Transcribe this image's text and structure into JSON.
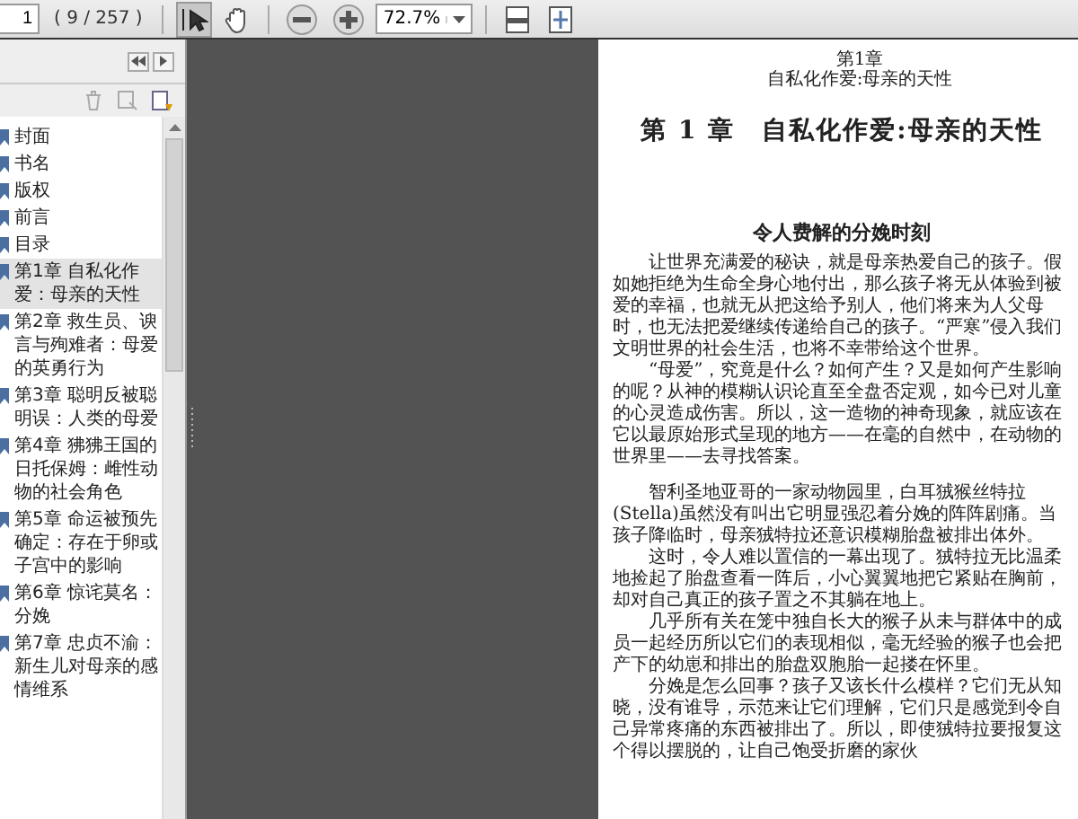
{
  "toolbar": {
    "page_number": "1",
    "page_count": "( 9 / 257 )",
    "tools": [
      {
        "kind": "select",
        "selected": true
      },
      {
        "kind": "hand",
        "selected": false
      }
    ],
    "zoom": "72.7%"
  },
  "sidebar": {
    "bookmarks": [
      {
        "label": "封面",
        "selected": false
      },
      {
        "label": "书名",
        "selected": false
      },
      {
        "label": "版权",
        "selected": false
      },
      {
        "label": "前言",
        "selected": false
      },
      {
        "label": "目录",
        "selected": false
      },
      {
        "label": "第1章 自私化作爱：母亲的天性",
        "selected": true
      },
      {
        "label": "第2章 救生员、谀言与殉难者：母爱的英勇行为",
        "selected": false
      },
      {
        "label": "第3章 聪明反被聪明误：人类的母爱",
        "selected": false
      },
      {
        "label": "第4章 狒狒王国的日托保姆：雌性动物的社会角色",
        "selected": false
      },
      {
        "label": "第5章 命运被预先确定：存在于卵或子宫中的影响",
        "selected": false
      },
      {
        "label": "第6章 惊诧莫名：分娩",
        "selected": false
      },
      {
        "label": "第7章 忠贞不渝：新生儿对母亲的感情维系",
        "selected": false
      }
    ]
  },
  "document": {
    "running_head": [
      "第1章",
      "自私化作爱:母亲的天性"
    ],
    "chapter_title": "第 1 章　自私化作爱:母亲的天性",
    "section_title": "令人费解的分娩时刻",
    "paragraph_groups": [
      [
        "让世界充满爱的秘诀，就是母亲热爱自己的孩子。假如她拒绝为生命全身心地付出，那么孩子将无从体验到被爱的幸福，也就无从把这给予别人，他们将来为人父母时，也无法把爱继续传递给自己的孩子。“严寒”侵入我们文明世界的社会生活，也将不幸带给这个世界。",
        "“母爱”，究竟是什么？如何产生？又是如何产生影响的呢？从神的模糊认识论直至全盘否定观，如今已对儿童的心灵造成伤害。所以，这一造物的神奇现象，就应该在它以最原始形式呈现的地方——在毫的自然中，在动物的世界里——去寻找答案。"
      ],
      [
        "智利圣地亚哥的一家动物园里，白耳狨猴丝特拉(Stella)虽然没有叫出它明显强忍着分娩的阵阵剧痛。当孩子降临时，母亲狨特拉还意识模糊胎盘被排出体外。",
        "这时，令人难以置信的一幕出现了。狨特拉无比温柔地捡起了胎盘查看一阵后，小心翼翼地把它紧贴在胸前，却对自己真正的孩子置之不其躺在地上。",
        "几乎所有关在笼中独自长大的猴子从未与群体中的成员一起经历所以它们的表现相似，毫无经验的猴子也会把产下的幼崽和排出的胎盘双胞胎一起搂在怀里。",
        "分娩是怎么回事？孩子又该长什么模样？它们无从知晓，没有谁导，示范来让它们理解，它们只是感觉到令自己异常疼痛的东西被排出了。所以，即使狨特拉要报复这个得以摆脱的，让自己饱受折磨的家伙"
      ]
    ]
  }
}
